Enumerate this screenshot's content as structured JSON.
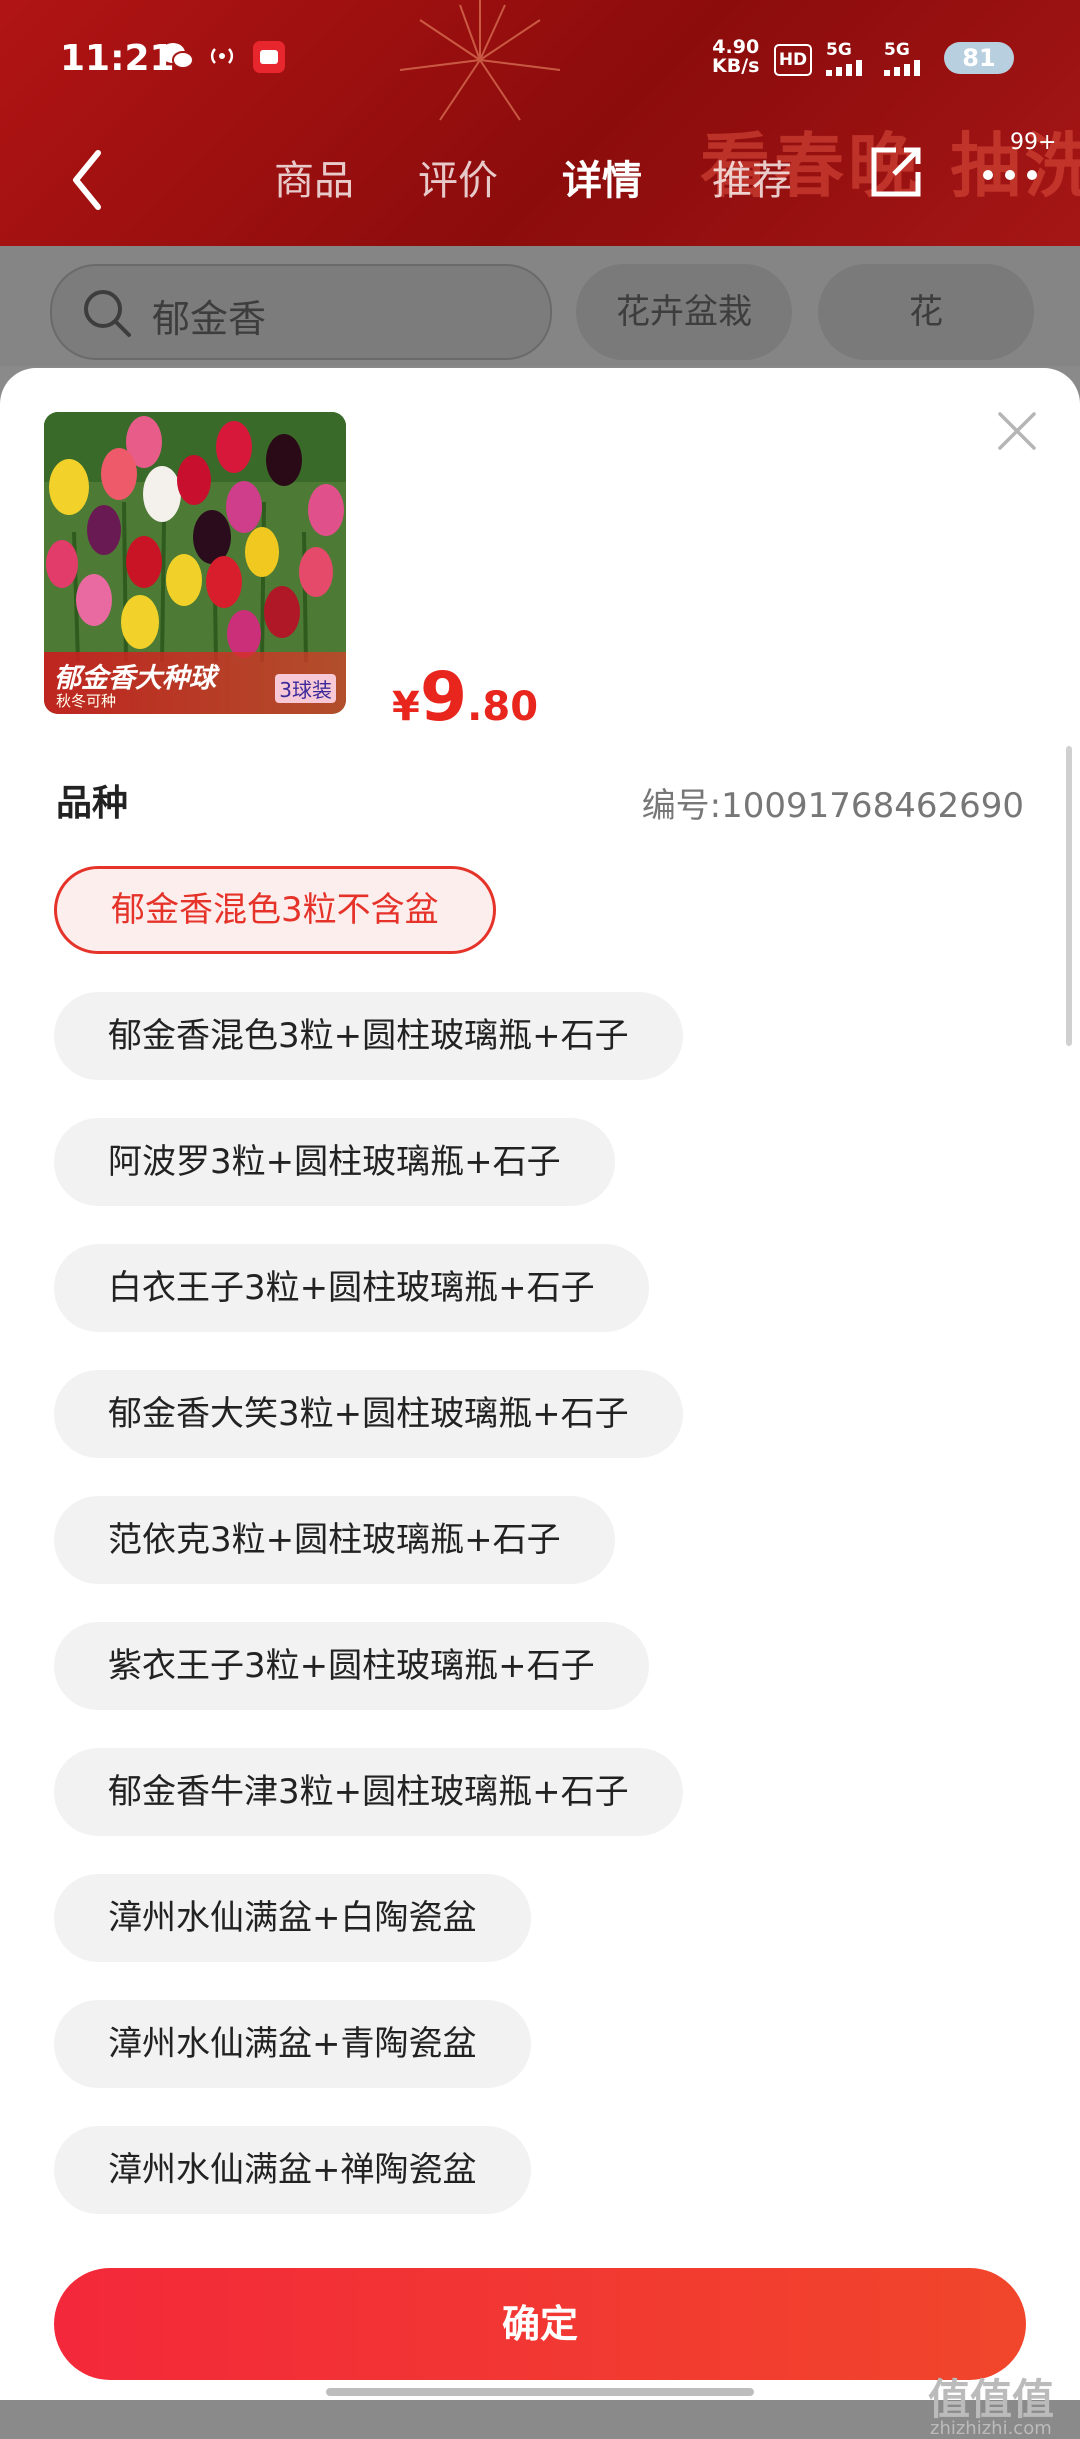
{
  "status_bar": {
    "time": "11:21",
    "net_speed_value": "4.90",
    "net_speed_unit": "KB/s",
    "hd_label": "HD",
    "signal1_label": "5G",
    "signal2_label": "5G",
    "battery": "81",
    "icons": [
      "wechat-icon",
      "hotspot-icon",
      "app-notification-icon",
      "signal-icon",
      "battery-icon"
    ]
  },
  "nav": {
    "tabs": [
      "商品",
      "评价",
      "详情",
      "推荐"
    ],
    "active_tab": "详情",
    "more_badge": "99+",
    "banner_text": "看春晚 抽洗"
  },
  "search": {
    "query": "郁金香",
    "chips": [
      "花卉盆栽",
      "花"
    ]
  },
  "sheet": {
    "product_image_caption": "郁金香大种球",
    "product_image_subcaption": "秋冬可种",
    "product_image_pack": "3球装",
    "price_currency": "¥",
    "price_int": "9",
    "price_dec": ".80",
    "section_title": "品种",
    "sku_code": "编号:10091768462690",
    "options": [
      "郁金香混色3粒不含盆",
      "郁金香混色3粒+圆柱玻璃瓶+石子",
      "阿波罗3粒+圆柱玻璃瓶+石子",
      "白衣王子3粒+圆柱玻璃瓶+石子",
      "郁金香大笑3粒+圆柱玻璃瓶+石子",
      "范依克3粒+圆柱玻璃瓶+石子",
      "紫衣王子3粒+圆柱玻璃瓶+石子",
      "郁金香牛津3粒+圆柱玻璃瓶+石子",
      "漳州水仙满盆+白陶瓷盆",
      "漳州水仙满盆+青陶瓷盆",
      "漳州水仙满盆+禅陶瓷盆"
    ],
    "selected_option": "郁金香混色3粒不含盆",
    "confirm_label": "确定"
  },
  "watermark": {
    "main": "值值值",
    "sub": "zhizhizhi.com"
  },
  "colors": {
    "accent": "#e5332a",
    "header_red": "#a51616",
    "confirm_gradient_start": "#f3283a",
    "confirm_gradient_end": "#f1462b"
  }
}
